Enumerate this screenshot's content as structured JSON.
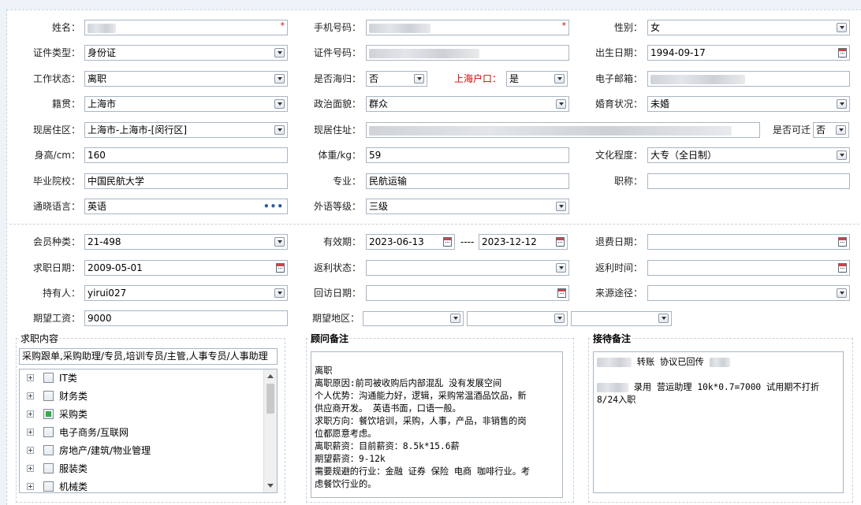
{
  "basic": {
    "name_label": "姓名：",
    "phone_label": "手机号码：",
    "gender_label": "性别：",
    "gender_value": "女",
    "id_type_label": "证件类型：",
    "id_type_value": "身份证",
    "id_no_label": "证件号码：",
    "birth_label": "出生日期：",
    "birth_value": "1994-09-17",
    "work_status_label": "工作状态：",
    "work_status_value": "离职",
    "overseas_label": "是否海归：",
    "overseas_value": "否",
    "hukou_label": "上海户口：",
    "hukou_value": "是",
    "email_label": "电子邮箱：",
    "native_label": "籍贯：",
    "native_value": "上海市",
    "politics_label": "政治面貌：",
    "politics_value": "群众",
    "marital_label": "婚育状况：",
    "marital_value": "未婚",
    "region_label": "现居住区：",
    "region_value": "上海市-上海市-[闵行区]",
    "address_label": "现居住址：",
    "relocate_label": "是否可迁",
    "relocate_value": "否",
    "height_label": "身高/cm：",
    "height_value": "160",
    "weight_label": "体重/kg：",
    "weight_value": "59",
    "edu_label": "文化程度：",
    "edu_value": "大专（全日制）",
    "school_label": "毕业院校：",
    "school_value": "中国民航大学",
    "major_label": "专业：",
    "major_value": "民航运输",
    "title_label": "职称：",
    "lang_label": "通晓语言：",
    "lang_value": "英语",
    "lang_more": "•••",
    "foreign_level_label": "外语等级：",
    "foreign_level_value": "三级",
    "required_mark": "*"
  },
  "member": {
    "type_label": "会员种类：",
    "type_value": "21-498",
    "valid_label": "有效期：",
    "valid_from": "2023-06-13",
    "valid_sep": "----",
    "valid_to": "2023-12-12",
    "refund_date_label": "退费日期：",
    "job_date_label": "求职日期：",
    "job_date_value": "2009-05-01",
    "rebate_status_label": "返利状态：",
    "rebate_time_label": "返利时间：",
    "holder_label": "持有人：",
    "holder_value": "yirui027",
    "visit_date_label": "回访日期：",
    "source_label": "来源途径：",
    "salary_label": "期望工资：",
    "salary_value": "9000",
    "area_label": "期望地区："
  },
  "job": {
    "title": "求职内容",
    "summary": "采购跟单,采购助理/专员,培训专员/主管,人事专员/人事助理",
    "tree": [
      {
        "label": "IT类",
        "state": "unchecked"
      },
      {
        "label": "财务类",
        "state": "unchecked"
      },
      {
        "label": "采购类",
        "state": "partial"
      },
      {
        "label": "电子商务/互联网",
        "state": "unchecked"
      },
      {
        "label": "房地产/建筑/物业管理",
        "state": "unchecked"
      },
      {
        "label": "服装类",
        "state": "unchecked"
      },
      {
        "label": "机械类",
        "state": "unchecked"
      }
    ]
  },
  "advisor": {
    "title": "顾问备注",
    "lines": [
      "离职",
      "离职原因:前司被收购后内部混乱 没有发展空间",
      "个人优势：沟通能力好，逻辑，采购常温酒品饮品，新",
      "供应商开发。  英语书面，口语一般。",
      "求职方向：餐饮培训，采购，人事，产品，非销售的岗",
      "位都愿意考虑。",
      "离职薪资：目前薪资：8.5k*15.6薪",
      "期望薪资：9-12k",
      "需要规避的行业：金融 证券 保险 电商 咖啡行业。考",
      "虑餐饮行业的。"
    ]
  },
  "reception": {
    "title": "接待备注",
    "line1": "转账  协议已回传",
    "line2": "录用 营运助理  10k*0.7=7000 试用期不打折",
    "line3": "8/24入职"
  }
}
